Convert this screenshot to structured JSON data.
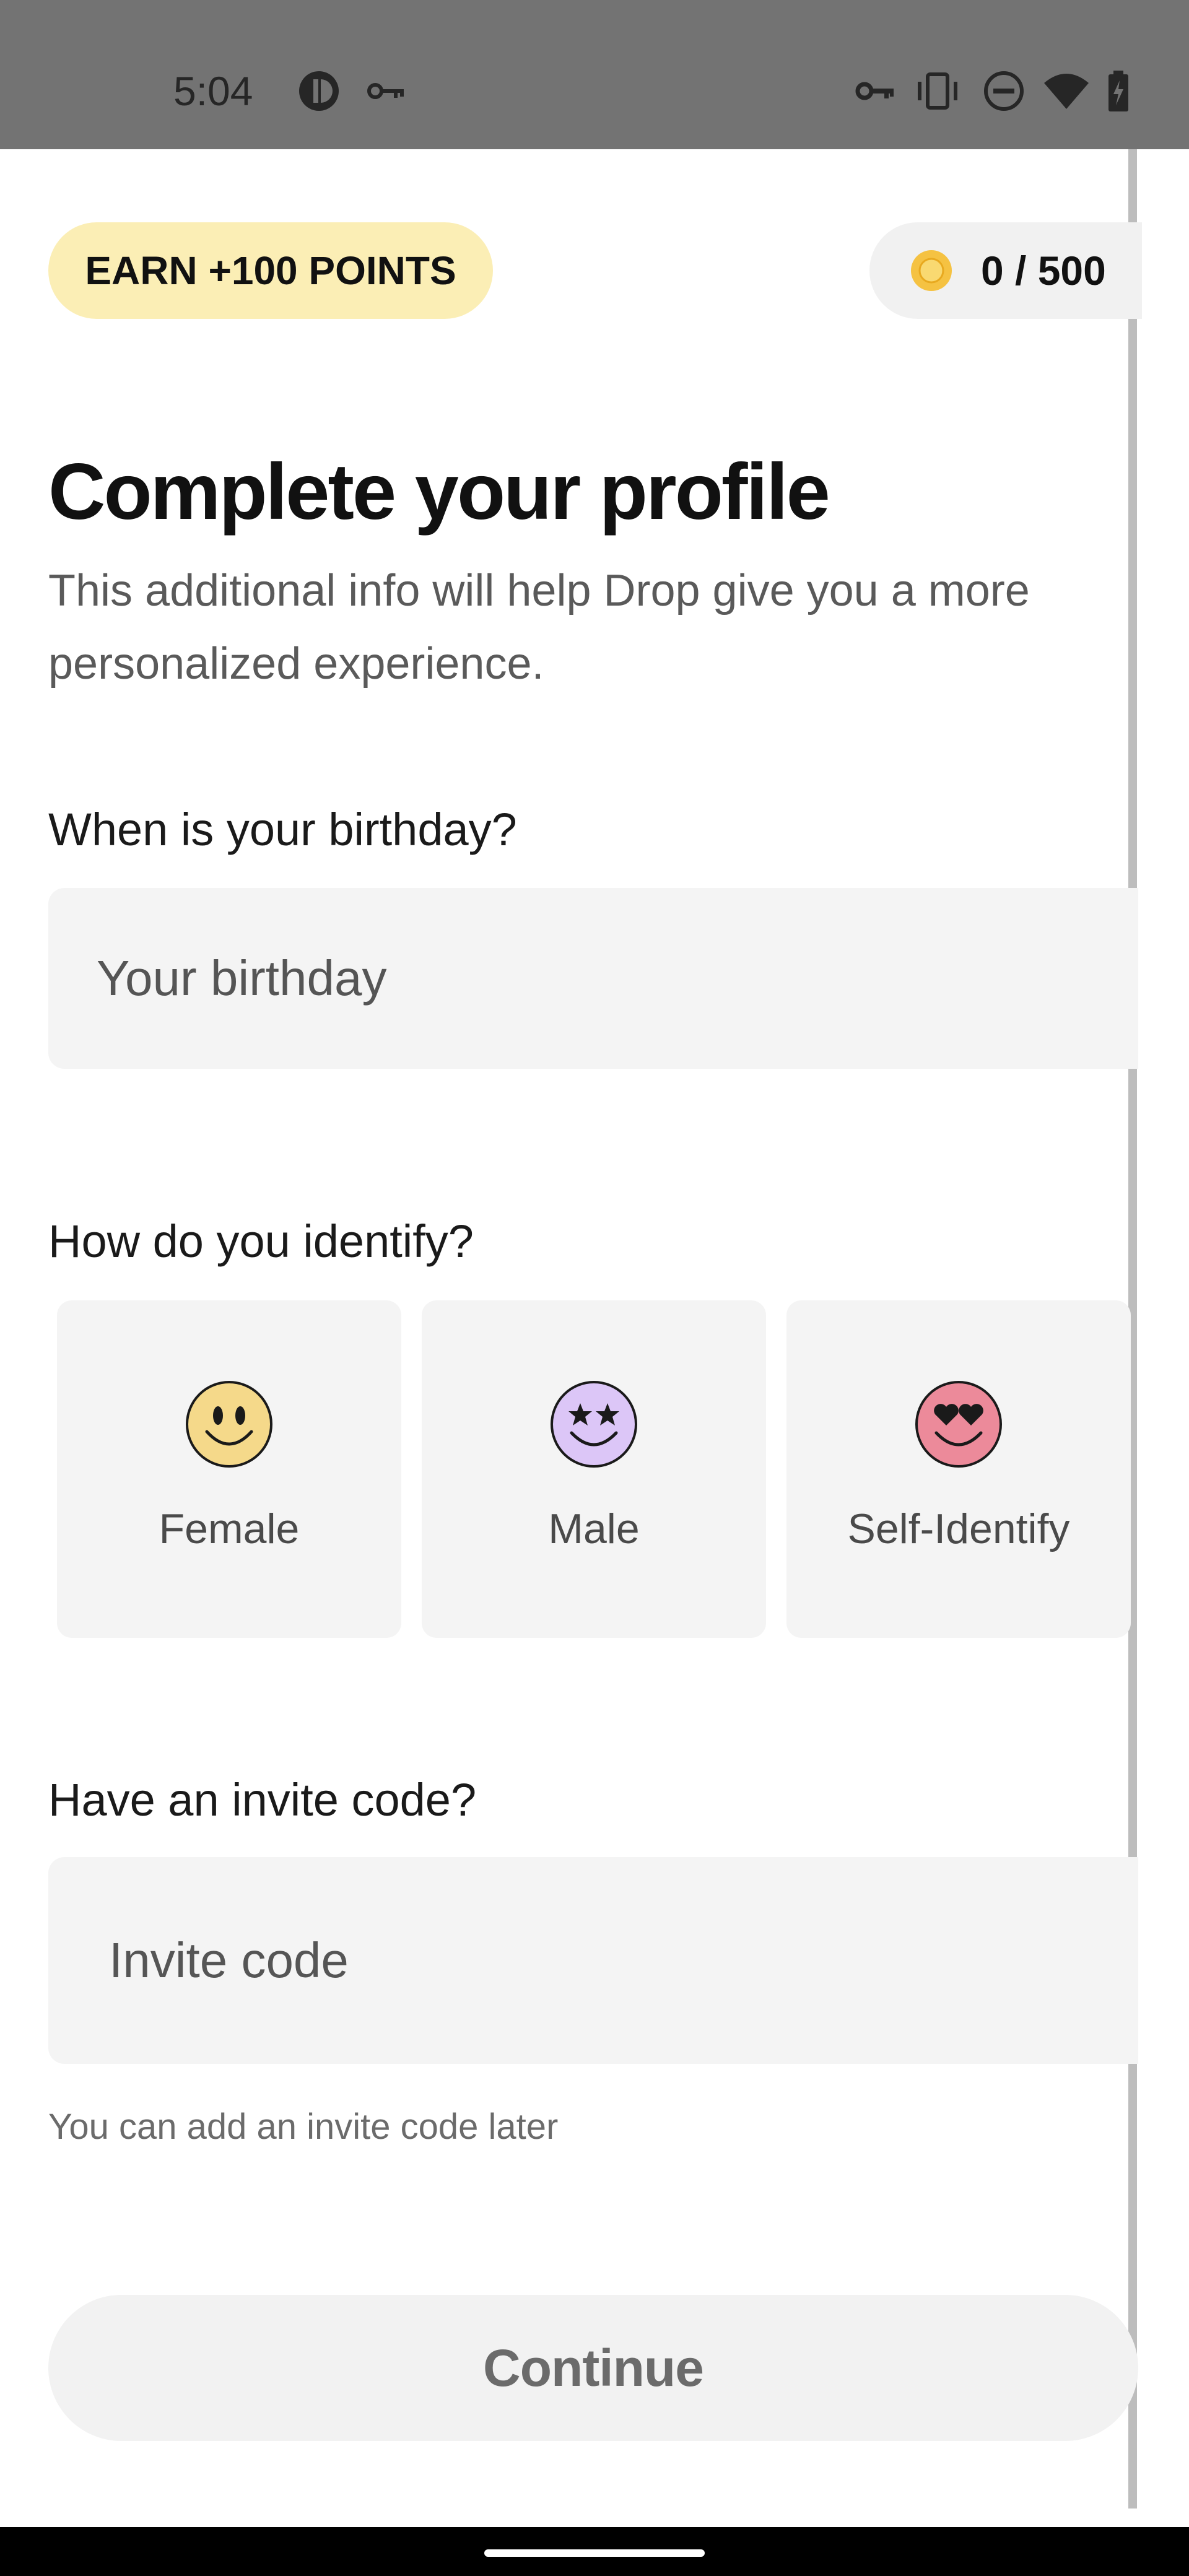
{
  "status_bar": {
    "time": "5:04",
    "left_icons": [
      "app-notification-icon",
      "key-icon"
    ],
    "right_icons": [
      "vpn-key-icon",
      "vibrate-icon",
      "do-not-disturb-icon",
      "wifi-icon",
      "battery-icon"
    ]
  },
  "header": {
    "earn_label": "EARN +100 POINTS",
    "points": "0 / 500",
    "coin_icon": "coin-icon",
    "coin_color": "#f5c242"
  },
  "profile": {
    "title": "Complete your profile",
    "subtitle": "This additional info will help Drop give you a more personalized experience.",
    "birthday_label": "When is your birthday?",
    "birthday_placeholder": "Your birthday",
    "identify_label": "How do you identify?",
    "options": [
      {
        "label": "Female",
        "icon": "smiley-face-icon",
        "color": "#f5d98a"
      },
      {
        "label": "Male",
        "icon": "star-eyes-face-icon",
        "color": "#dcc6f7"
      },
      {
        "label": "Self-Identify",
        "icon": "heart-eyes-face-icon",
        "color": "#ec8a9a"
      }
    ],
    "invite_label": "Have an invite code?",
    "invite_placeholder": "Invite code",
    "invite_helper": "You can add an invite code later",
    "continue_label": "Continue"
  }
}
